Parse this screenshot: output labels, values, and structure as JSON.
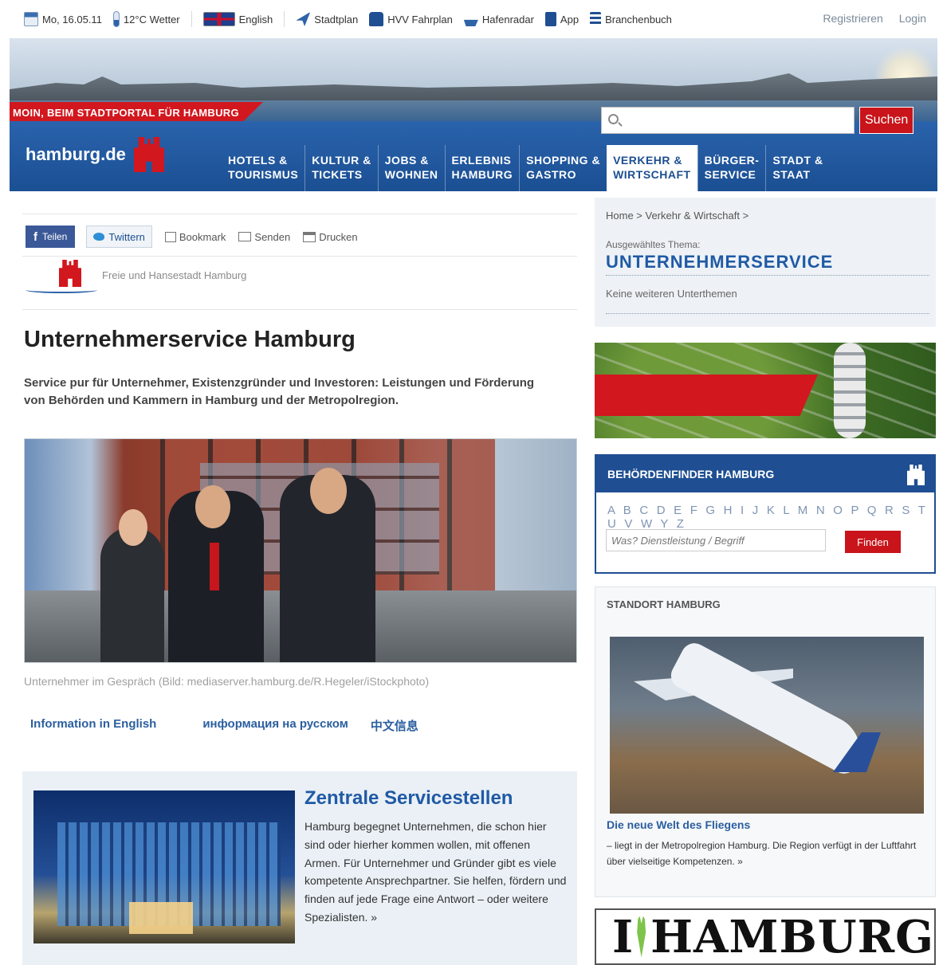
{
  "topbar": {
    "date": "Mo, 16.05.11",
    "weather": "12°C Wetter",
    "language": "English",
    "links": [
      "Stadtplan",
      "HVV Fahrplan",
      "Hafenradar",
      "App",
      "Branchenbuch"
    ],
    "register": "Registrieren",
    "login": "Login"
  },
  "header": {
    "greeting": "MOIN, BEIM STADTPORTAL FÜR HAMBURG",
    "logo": "hamburg.de",
    "search_placeholder": "",
    "search_button": "Suchen"
  },
  "nav": {
    "tabs": [
      {
        "line1": "HOTELS &",
        "line2": "TOURISMUS"
      },
      {
        "line1": "KULTUR &",
        "line2": "TICKETS"
      },
      {
        "line1": "JOBS &",
        "line2": "WOHNEN"
      },
      {
        "line1": "ERLEBNIS",
        "line2": "HAMBURG"
      },
      {
        "line1": "SHOPPING &",
        "line2": "GASTRO"
      },
      {
        "line1": "VERKEHR &",
        "line2": "WIRTSCHAFT"
      },
      {
        "line1": "BÜRGER-",
        "line2": "SERVICE"
      },
      {
        "line1": "STADT &",
        "line2": "STAAT"
      }
    ],
    "active_index": 5
  },
  "share": {
    "facebook": "Teilen",
    "twitter": "Twittern",
    "bookmark": "Bookmark",
    "send": "Senden",
    "print": "Drucken"
  },
  "fhh_label": "Freie und Hansestadt Hamburg",
  "main": {
    "title": "Unternehmerservice Hamburg",
    "lead": "Service pur für Unternehmer, Existenzgründer und Investoren: Leistungen und Förderung von Behörden und Kammern in Hamburg und der Metropolregion.",
    "caption": "Unternehmer im Gespräch (Bild: mediaserver.hamburg.de/R.Hegeler/iStockphoto)",
    "languages": [
      "Information in English",
      "информация на русском",
      "中文信息"
    ]
  },
  "service_box": {
    "title": "Zentrale Servicestellen",
    "text": "Hamburg begegnet Unternehmen, die schon hier sind oder hierher kommen wollen, mit offenen Armen. Für Unternehmer und Gründer gibt es viele kompetente Ansprechpartner. Sie helfen, fördern und finden auf jede Frage eine Antwort – oder weitere Spezialisten. »"
  },
  "sidebar": {
    "breadcrumb": "Home > Verkehr & Wirtschaft >",
    "selected_label": "Ausgewähltes Thema:",
    "topic": "UNTERNEHMERSERVICE",
    "no_subtopics": "Keine weiteren Unterthemen"
  },
  "behoerdenfinder": {
    "title": "BEHÖRDENFINDER HAMBURG",
    "alphabet": "A B C D E F G H I J K L M N O P Q R S T U V W Y Z",
    "input_placeholder": "Was? Dienstleistung / Begriff",
    "button": "Finden"
  },
  "standort": {
    "title": "STANDORT HAMBURG",
    "link": "Die neue Welt des Fliegens",
    "text": "– liegt in der Metropolregion Hamburg. Die Region verfügt in der Luftfahrt über vielseitige Kompetenzen. »"
  },
  "ilove": {
    "left": "I",
    "right": "HAMBURG"
  },
  "colors": {
    "brand_blue": "#1d4f91",
    "brand_red": "#d2171e",
    "link_blue": "#2b5f9f"
  }
}
